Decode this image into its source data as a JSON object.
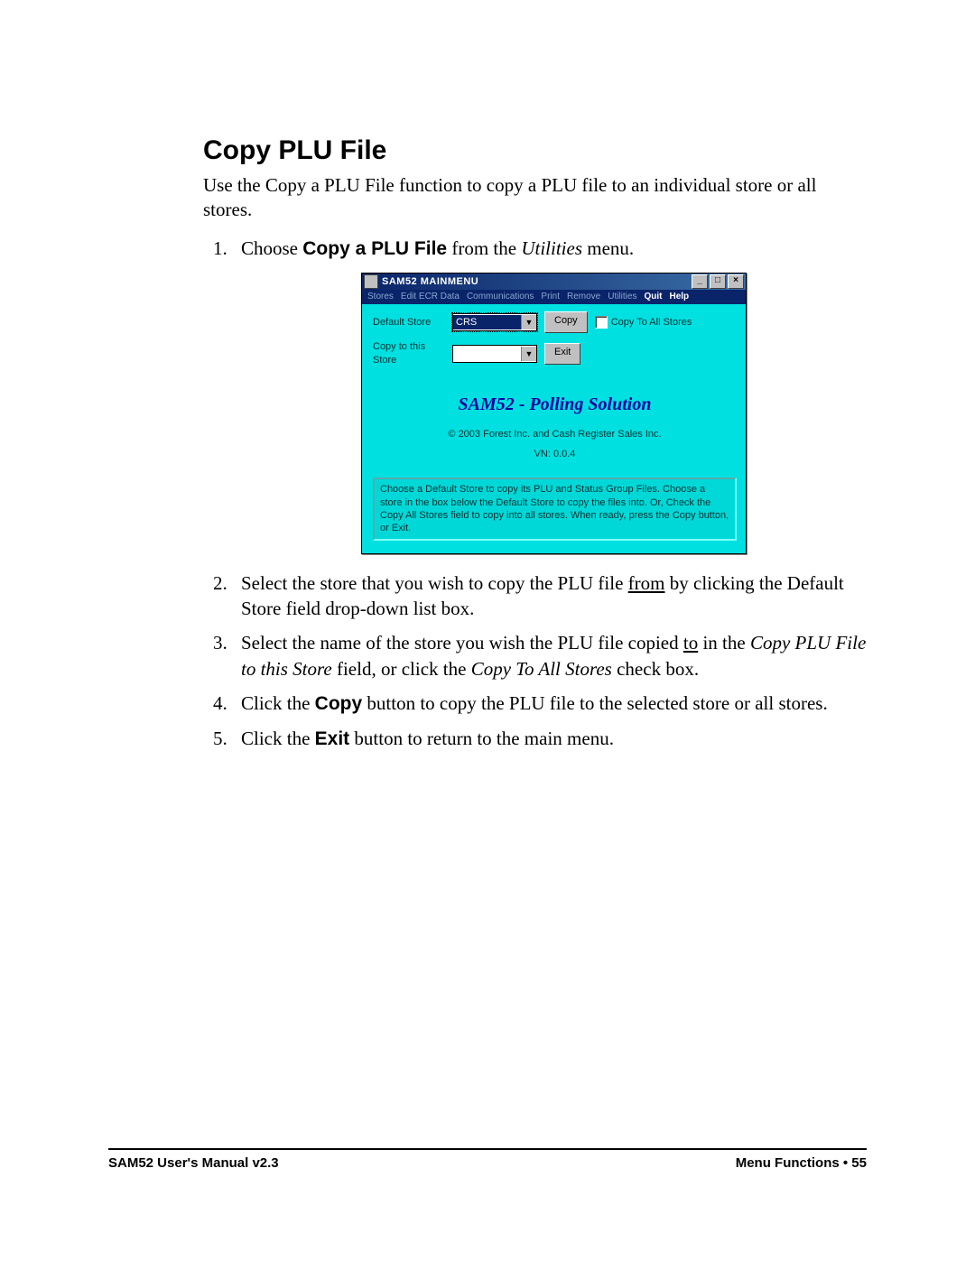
{
  "doc": {
    "heading": "Copy PLU File",
    "intro": "Use the Copy a PLU File function to copy a PLU file to an individual store or all stores.",
    "steps": {
      "s1_a": "Choose ",
      "s1_b": "Copy a PLU File",
      "s1_c": " from the ",
      "s1_d": "Utilities",
      "s1_e": " menu.",
      "s2_a": "Select the store that you wish to copy the PLU file ",
      "s2_u": "from",
      "s2_b": " by clicking the Default Store field drop-down list box.",
      "s3_a": "Select the name of the store you wish the PLU file copied ",
      "s3_u": "to",
      "s3_b": " in the ",
      "s3_i": "Copy PLU File to this Store",
      "s3_c": " field, or click the ",
      "s3_i2": "Copy To All Stores",
      "s3_d": " check box.",
      "s4_a": "Click the ",
      "s4_b": "Copy",
      "s4_c": " button to copy the PLU file to the selected store or all stores.",
      "s5_a": "Click the ",
      "s5_b": "Exit",
      "s5_c": " button to return to the main menu."
    }
  },
  "app": {
    "title": "SAM52 MAINMENU",
    "menus": {
      "stores": "Stores",
      "edit": "Edit ECR Data",
      "comm": "Communications",
      "print": "Print",
      "remove": "Remove",
      "util": "Utilities",
      "quit": "Quit",
      "help": "Help"
    },
    "labels": {
      "default_store": "Default Store",
      "copy_to": "Copy to this Store",
      "copy_all": "Copy To All Stores"
    },
    "values": {
      "default_store": "CRS",
      "copy_to": ""
    },
    "buttons": {
      "copy": "Copy",
      "exit": "Exit"
    },
    "branding": {
      "title": "SAM52 - Polling Solution",
      "copyright": "© 2003 Forest Inc. and Cash Register Sales Inc.",
      "version": "VN: 0.0.4"
    },
    "info": "Choose a Default Store to copy its PLU and Status Group Files.  Choose a store in the box below the Default Store to copy the files into.  Or, Check the Copy All Stores field to copy into all stores. When ready, press the Copy button, or Exit."
  },
  "footer": {
    "left": "SAM52 User's Manual v2.3",
    "right_a": "Menu Functions  ",
    "right_dot": "•",
    "right_b": "  55"
  }
}
